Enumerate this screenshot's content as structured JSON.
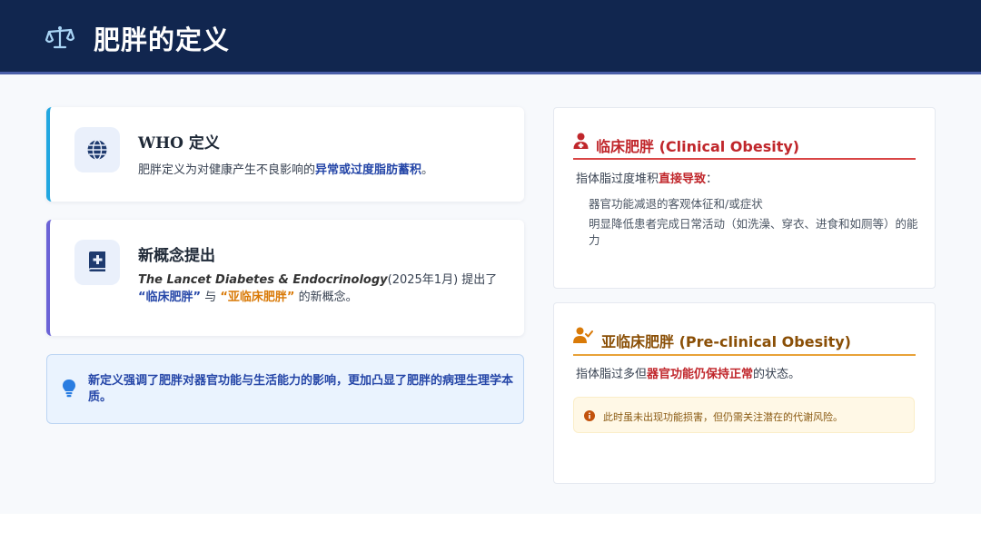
{
  "header": {
    "title": "肥胖的定义",
    "icon": "balance-scale-icon"
  },
  "who_card": {
    "icon": "globe-icon",
    "title": "WHO 定义",
    "text_prefix": "肥胖定义为对健康产生不良影响的",
    "text_highlight": "异常或过度脂肪蓄积",
    "text_suffix": "。"
  },
  "new_concept_card": {
    "icon": "medical-book-icon",
    "title": "新概念提出",
    "journal": "The Lancet Diabetes & Endocrinology",
    "text_after_journal": "(2025年1月) 提出了",
    "term_clinical": "“临床肥胖”",
    "conjunction": "与",
    "term_preclinical": "“亚临床肥胖”",
    "text_end": "的新概念。"
  },
  "note": {
    "icon": "lightbulb-icon",
    "text": "新定义强调了肥胖对器官功能与生活能力的影响，更加凸显了肥胖的病理生理学本质。"
  },
  "clinical": {
    "icon": "user-medical-icon",
    "title": "临床肥胖 (Clinical Obesity)",
    "lead_prefix": "指体脂过度堆积",
    "lead_highlight": "直接导致",
    "lead_suffix": "：",
    "items": [
      "器官功能减退的客观体征和/或症状",
      "明显降低患者完成日常活动（如洗澡、穿衣、进食和如厕等）的能力"
    ]
  },
  "preclinical": {
    "icon": "user-check-icon",
    "title": "亚临床肥胖 (Pre-clinical Obesity)",
    "lead_prefix": "指体脂过多但",
    "lead_highlight": "器官功能仍保持正常",
    "lead_suffix": "的状态。",
    "warning_icon": "info-circle-icon",
    "warning": "此时虽未出现功能损害，但仍需关注潜在的代谢风险。"
  },
  "colors": {
    "header_bg": "#11264f",
    "accent_blue": "#22a7e0",
    "accent_purple": "#6b63d6",
    "clinical_red": "#c0262b",
    "preclinical_orange": "#d97a08"
  }
}
